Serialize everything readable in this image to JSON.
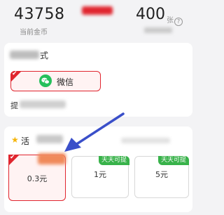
{
  "header": {
    "coins_value": "43758",
    "coins_label": "当前金币",
    "tickets_value": "400",
    "tickets_unit": "张",
    "help_icon": "?"
  },
  "withdraw_method": {
    "title_suffix": "式",
    "options": [
      {
        "label": "微信",
        "icon": "wechat-icon",
        "selected": true
      }
    ],
    "bind_prefix": "提"
  },
  "activity": {
    "title_prefix": "活",
    "amounts": [
      {
        "value": "0.3元",
        "selected": true
      },
      {
        "value": "1元",
        "tag": "天天可提",
        "selected": false
      },
      {
        "value": "5元",
        "tag": "天天可提",
        "selected": false
      }
    ]
  },
  "colors": {
    "accent": "#e0262f",
    "wechat": "#25c05b",
    "tag": "#38b24a",
    "arrow": "#3a4fc9"
  }
}
